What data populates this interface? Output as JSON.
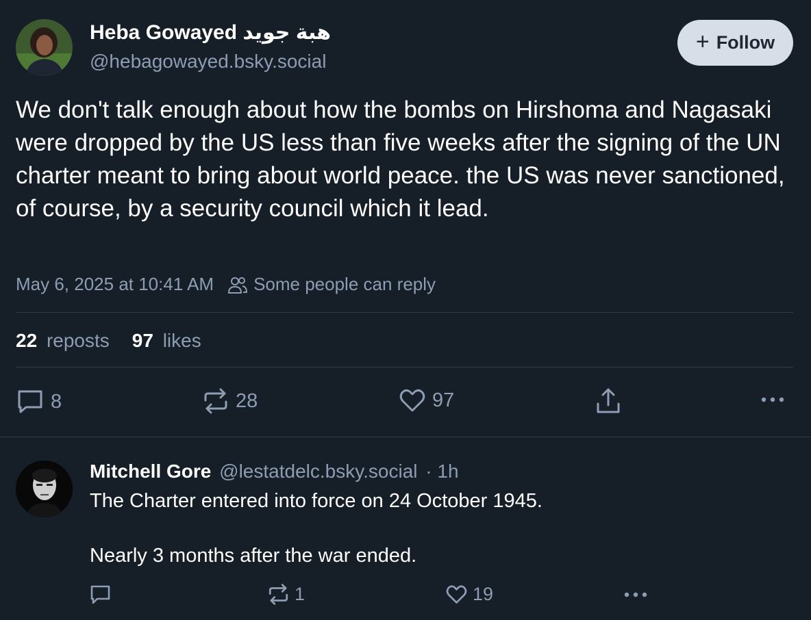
{
  "post": {
    "author_name": "Heba Gowayed هبة جويد",
    "author_handle": "@hebagowayed.bsky.social",
    "follow_label": "Follow",
    "text": "We don't talk enough about how the bombs on Hirshoma and Nagasaki were dropped by the US less than five weeks after the signing of the UN charter meant to bring about world peace. the US was never sanctioned, of course, by a security council which it lead.",
    "timestamp": "May 6, 2025 at 10:41 AM",
    "reply_setting": "Some people can reply",
    "reposts_count": "22",
    "reposts_label": "reposts",
    "likes_count": "97",
    "likes_label": "likes",
    "actions": {
      "reply_count": "8",
      "repost_count": "28",
      "like_count": "97"
    }
  },
  "reply": {
    "author_name": "Mitchell Gore",
    "author_handle": "@lestatdelc.bsky.social",
    "time": "· 1h",
    "line1": "The Charter entered into force on 24 October 1945.",
    "line2": "Nearly 3 months after the war ended.",
    "actions": {
      "reply_count": "",
      "repost_count": "1",
      "like_count": "19"
    }
  },
  "colors": {
    "background": "#161e27",
    "muted_text": "#8d9db3",
    "divider": "#2e3b4d",
    "follow_button_bg": "#d7dee8"
  },
  "icons": [
    "reply-icon",
    "repost-icon",
    "like-icon",
    "share-icon",
    "more-icon",
    "people-icon",
    "plus-icon"
  ]
}
